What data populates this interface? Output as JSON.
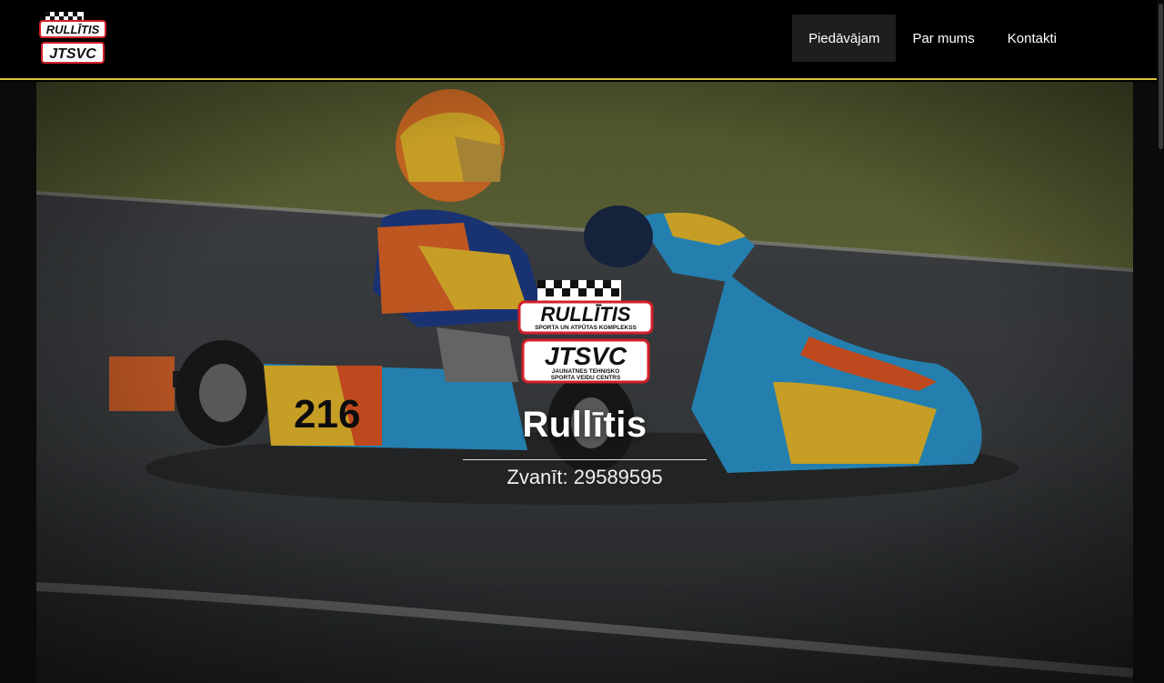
{
  "header": {
    "logo_alt": "Rullītis / JTSVC",
    "logo_top_text": "RULLĪTIS",
    "logo_bottom_text": "JTSVC",
    "nav": [
      {
        "label": "Piedāvājam",
        "active": true
      },
      {
        "label": "Par mums",
        "active": false
      },
      {
        "label": "Kontakti",
        "active": false
      }
    ]
  },
  "hero": {
    "logo_top_text": "RULLĪTIS",
    "logo_top_sub": "SPORTA UN ATPŪTAS KOMPLEKSS",
    "logo_bottom_text": "JTSVC",
    "logo_bottom_sub1": "JAUNATNES TEHNISKO",
    "logo_bottom_sub2": "SPORTA VEIDU CENTRS",
    "title": "Rullītis",
    "phone": "Zvanīt: 29589595",
    "kart_number": "216"
  },
  "colors": {
    "accent": "#d8c23a",
    "header_bg": "#000000",
    "nav_active_bg": "#1e1e1e",
    "logo_red": "#d3202a"
  }
}
